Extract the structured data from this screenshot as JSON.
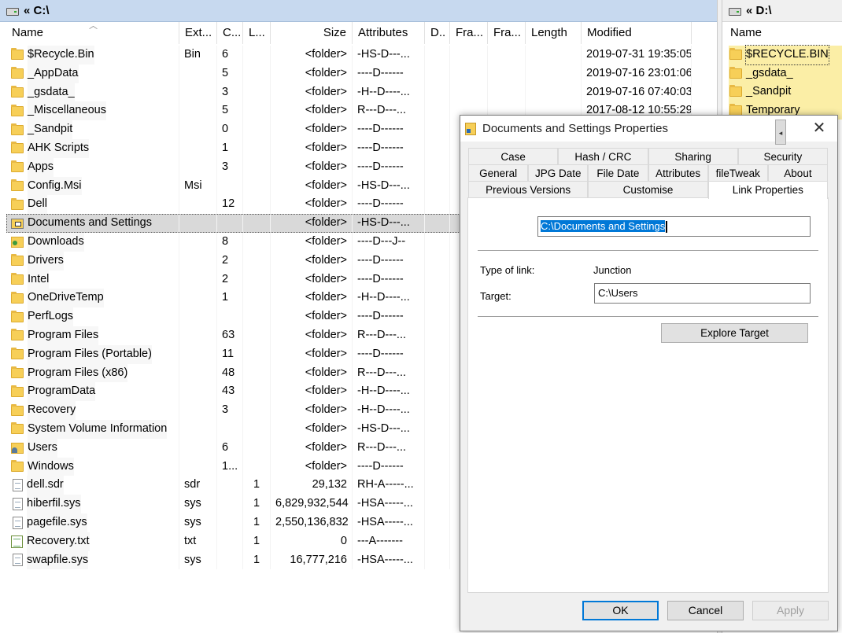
{
  "left_pane": {
    "path": "« C:\\",
    "columns": [
      "Name",
      "Ext...",
      "C...",
      "L...",
      "Size",
      "Attributes",
      "D..",
      "Fra...",
      "Fra...",
      "Length",
      "Modified"
    ],
    "rows": [
      {
        "icon": "folder-icon",
        "name": "$Recycle.Bin",
        "ext": "Bin",
        "c": "6",
        "l": "",
        "size": "<folder>",
        "attr": "-HS-D---...",
        "mod": "2019-07-31 19:35:05"
      },
      {
        "icon": "folder-icon",
        "name": "_AppData",
        "ext": "",
        "c": "5",
        "l": "",
        "size": "<folder>",
        "attr": "----D------",
        "mod": "2019-07-16 23:01:06"
      },
      {
        "icon": "folder-icon",
        "name": "_gsdata_",
        "ext": "",
        "c": "3",
        "l": "",
        "size": "<folder>",
        "attr": "-H--D----...",
        "mod": "2019-07-16 07:40:03"
      },
      {
        "icon": "folder-icon",
        "name": "_Miscellaneous",
        "ext": "",
        "c": "5",
        "l": "",
        "size": "<folder>",
        "attr": "R---D---...",
        "mod": "2017-08-12 10:55:29"
      },
      {
        "icon": "folder-icon",
        "name": "_Sandpit",
        "ext": "",
        "c": "0",
        "l": "",
        "size": "<folder>",
        "attr": "----D------",
        "mod": ""
      },
      {
        "icon": "folder-icon",
        "name": "AHK Scripts",
        "ext": "",
        "c": "1",
        "l": "",
        "size": "<folder>",
        "attr": "----D------",
        "mod": ""
      },
      {
        "icon": "folder-icon",
        "name": "Apps",
        "ext": "",
        "c": "3",
        "l": "",
        "size": "<folder>",
        "attr": "----D------",
        "mod": ""
      },
      {
        "icon": "folder-icon",
        "name": "Config.Msi",
        "ext": "Msi",
        "c": "",
        "l": "",
        "size": "<folder>",
        "attr": "-HS-D---...",
        "mod": ""
      },
      {
        "icon": "folder-icon",
        "name": "Dell",
        "ext": "",
        "c": "12",
        "l": "",
        "size": "<folder>",
        "attr": "----D------",
        "mod": ""
      },
      {
        "icon": "link-folder-icon",
        "name": "Documents and Settings",
        "ext": "",
        "c": "",
        "l": "",
        "size": "<folder>",
        "attr": "-HS-D---...",
        "mod": "",
        "selected": true
      },
      {
        "icon": "download-icon",
        "name": "Downloads",
        "ext": "",
        "c": "8",
        "l": "",
        "size": "<folder>",
        "attr": "----D---J--",
        "mod": ""
      },
      {
        "icon": "folder-icon",
        "name": "Drivers",
        "ext": "",
        "c": "2",
        "l": "",
        "size": "<folder>",
        "attr": "----D------",
        "mod": ""
      },
      {
        "icon": "folder-icon",
        "name": "Intel",
        "ext": "",
        "c": "2",
        "l": "",
        "size": "<folder>",
        "attr": "----D------",
        "mod": ""
      },
      {
        "icon": "folder-icon",
        "name": "OneDriveTemp",
        "ext": "",
        "c": "1",
        "l": "",
        "size": "<folder>",
        "attr": "-H--D----...",
        "mod": ""
      },
      {
        "icon": "folder-icon",
        "name": "PerfLogs",
        "ext": "",
        "c": "",
        "l": "",
        "size": "<folder>",
        "attr": "----D------",
        "mod": ""
      },
      {
        "icon": "folder-icon",
        "name": "Program Files",
        "ext": "",
        "c": "63",
        "l": "",
        "size": "<folder>",
        "attr": "R---D---...",
        "mod": ""
      },
      {
        "icon": "folder-icon",
        "name": "Program Files (Portable)",
        "ext": "",
        "c": "11",
        "l": "",
        "size": "<folder>",
        "attr": "----D------",
        "mod": ""
      },
      {
        "icon": "folder-icon",
        "name": "Program Files (x86)",
        "ext": "",
        "c": "48",
        "l": "",
        "size": "<folder>",
        "attr": "R---D---...",
        "mod": ""
      },
      {
        "icon": "folder-icon",
        "name": "ProgramData",
        "ext": "",
        "c": "43",
        "l": "",
        "size": "<folder>",
        "attr": "-H--D----...",
        "mod": ""
      },
      {
        "icon": "folder-icon",
        "name": "Recovery",
        "ext": "",
        "c": "3",
        "l": "",
        "size": "<folder>",
        "attr": "-H--D----...",
        "mod": ""
      },
      {
        "icon": "folder-icon",
        "name": "System Volume Information",
        "ext": "",
        "c": "",
        "l": "",
        "size": "<folder>",
        "attr": "-HS-D---...",
        "mod": ""
      },
      {
        "icon": "users-icon",
        "name": "Users",
        "ext": "",
        "c": "6",
        "l": "",
        "size": "<folder>",
        "attr": "R---D---...",
        "mod": ""
      },
      {
        "icon": "folder-icon",
        "name": "Windows",
        "ext": "",
        "c": "1...",
        "l": "",
        "size": "<folder>",
        "attr": "----D------",
        "mod": ""
      },
      {
        "icon": "file-icon",
        "name": "dell.sdr",
        "ext": "sdr",
        "c": "",
        "l": "1",
        "size": "29,132",
        "attr": "RH-A-----...",
        "mod": ""
      },
      {
        "icon": "file-icon",
        "name": "hiberfil.sys",
        "ext": "sys",
        "c": "",
        "l": "1",
        "size": "6,829,932,544",
        "attr": "-HSA-----...",
        "mod": ""
      },
      {
        "icon": "file-icon",
        "name": "pagefile.sys",
        "ext": "sys",
        "c": "",
        "l": "1",
        "size": "2,550,136,832",
        "attr": "-HSA-----...",
        "mod": ""
      },
      {
        "icon": "txt-icon",
        "name": "Recovery.txt",
        "ext": "txt",
        "c": "",
        "l": "1",
        "size": "0",
        "attr": "---A-------",
        "mod": ""
      },
      {
        "icon": "file-icon",
        "name": "swapfile.sys",
        "ext": "sys",
        "c": "",
        "l": "1",
        "size": "16,777,216",
        "attr": "-HSA-----...",
        "mod": ""
      }
    ]
  },
  "right_pane": {
    "path": "« D:\\",
    "column": "Name",
    "rows": [
      "$RECYCLE.BIN",
      "_gsdata_",
      "_Sandpit",
      "Temporary"
    ]
  },
  "dialog": {
    "title": "Documents and Settings Properties",
    "tab_rows": [
      [
        "Case",
        "Hash / CRC",
        "Sharing",
        "Security"
      ],
      [
        "General",
        "JPG Date",
        "File Date",
        "Attributes",
        "fileTweak",
        "About"
      ],
      [
        "Previous Versions",
        "Customise",
        "Link Properties"
      ]
    ],
    "active_tab": "Link Properties",
    "link_path": "C:\\Documents and Settings",
    "type_label": "Type of link:",
    "type_value": "Junction",
    "target_label": "Target:",
    "target_value": "C:\\Users",
    "explore_label": "Explore Target",
    "ok_label": "OK",
    "cancel_label": "Cancel",
    "apply_label": "Apply",
    "close_glyph": "✕"
  }
}
